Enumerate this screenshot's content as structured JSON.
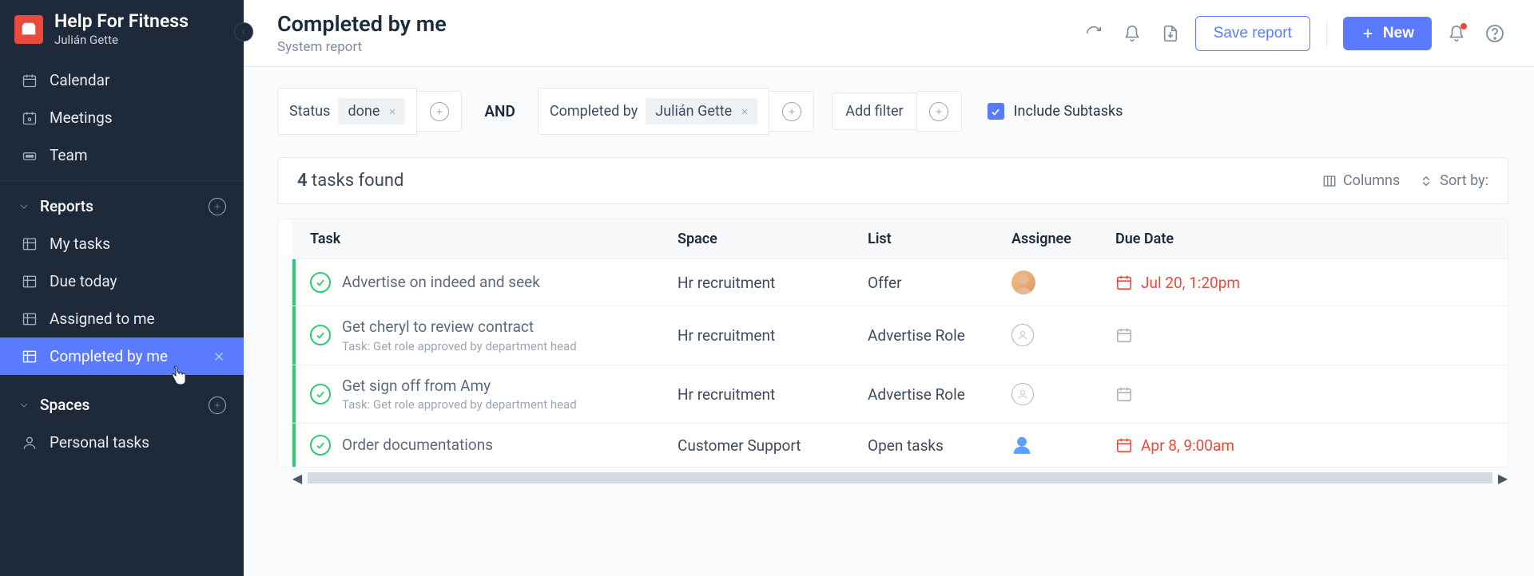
{
  "workspace": {
    "name": "Help For Fitness",
    "user": "Julián Gette"
  },
  "nav": {
    "primary": [
      {
        "key": "calendar",
        "label": "Calendar"
      },
      {
        "key": "meetings",
        "label": "Meetings"
      },
      {
        "key": "team",
        "label": "Team"
      }
    ],
    "reports_header": "Reports",
    "reports": [
      {
        "key": "my-tasks",
        "label": "My tasks"
      },
      {
        "key": "due-today",
        "label": "Due today"
      },
      {
        "key": "assigned-to-me",
        "label": "Assigned to me"
      },
      {
        "key": "completed-by-me",
        "label": "Completed by me",
        "active": true
      }
    ],
    "spaces_header": "Spaces",
    "spaces": [
      {
        "key": "personal-tasks",
        "label": "Personal tasks"
      }
    ]
  },
  "header": {
    "title": "Completed by me",
    "subtitle": "System report",
    "save_report": "Save report",
    "new_button": "New"
  },
  "filters": {
    "status_label": "Status",
    "status_value": "done",
    "connector": "AND",
    "completed_by_label": "Completed by",
    "completed_by_value": "Julián Gette",
    "add_filter": "Add filter",
    "include_subtasks": "Include Subtasks"
  },
  "results": {
    "count": 4,
    "count_label": "tasks found",
    "columns_label": "Columns",
    "sort_label": "Sort by:",
    "headers": {
      "task": "Task",
      "space": "Space",
      "list": "List",
      "assignee": "Assignee",
      "due": "Due Date"
    },
    "rows": [
      {
        "title": "Advertise on indeed and seek",
        "subtitle": "",
        "space": "Hr recruitment",
        "list": "Offer",
        "assignee": "photo",
        "due": "Jul 20, 1:20pm",
        "overdue": true
      },
      {
        "title": "Get cheryl to review contract",
        "subtitle": "Task: Get role approved by department head",
        "space": "Hr recruitment",
        "list": "Advertise Role",
        "assignee": "placeholder",
        "due": "",
        "overdue": false
      },
      {
        "title": "Get sign off from Amy",
        "subtitle": "Task: Get role approved by department head",
        "space": "Hr recruitment",
        "list": "Advertise Role",
        "assignee": "placeholder",
        "due": "",
        "overdue": false
      },
      {
        "title": "Order documentations",
        "subtitle": "",
        "space": "Customer Support",
        "list": "Open tasks",
        "assignee": "filled",
        "due": "Apr 8, 9:00am",
        "overdue": true
      }
    ]
  }
}
